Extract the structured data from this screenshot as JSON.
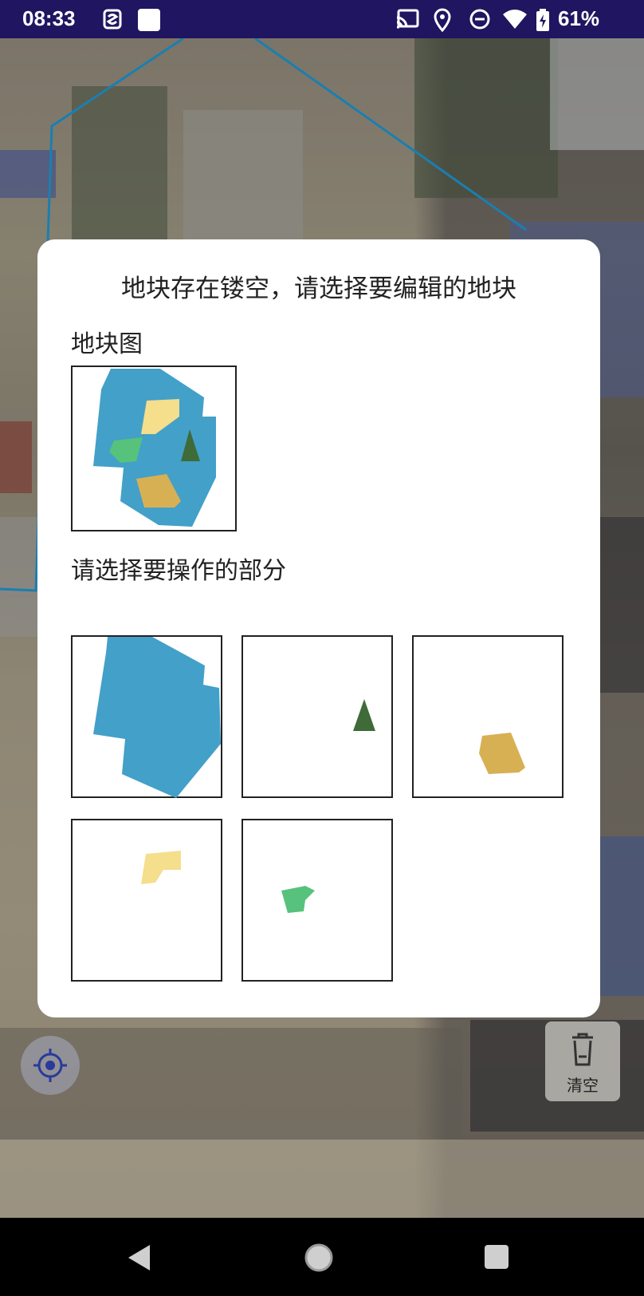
{
  "status_bar": {
    "time": "08:33",
    "battery": "61%",
    "icons": [
      "s-app-icon",
      "square-app-icon",
      "cast-icon",
      "location-icon",
      "do-not-disturb-icon",
      "wifi-icon",
      "battery-charging-icon"
    ]
  },
  "dialog": {
    "title": "地块存在镂空，请选择要编辑的地块",
    "plot_map_label": "地块图",
    "select_part_label": "请选择要操作的部分",
    "colors": {
      "main_plot": "#43A0C8",
      "dark_green": "#3E6B38",
      "gold": "#D8B054",
      "light_yellow": "#F5DE8C",
      "green": "#56C27C"
    },
    "parts": [
      {
        "name": "blue-main-part"
      },
      {
        "name": "dark-green-triangle-part"
      },
      {
        "name": "gold-part"
      },
      {
        "name": "light-yellow-part"
      },
      {
        "name": "green-part"
      }
    ]
  },
  "controls": {
    "clear_label": "清空",
    "locate_icon": "crosshair-icon",
    "clear_icon": "trash-icon"
  },
  "nav_bar": {
    "back_icon": "back-triangle-icon",
    "home_icon": "home-circle-icon",
    "recents_icon": "recents-square-icon"
  }
}
